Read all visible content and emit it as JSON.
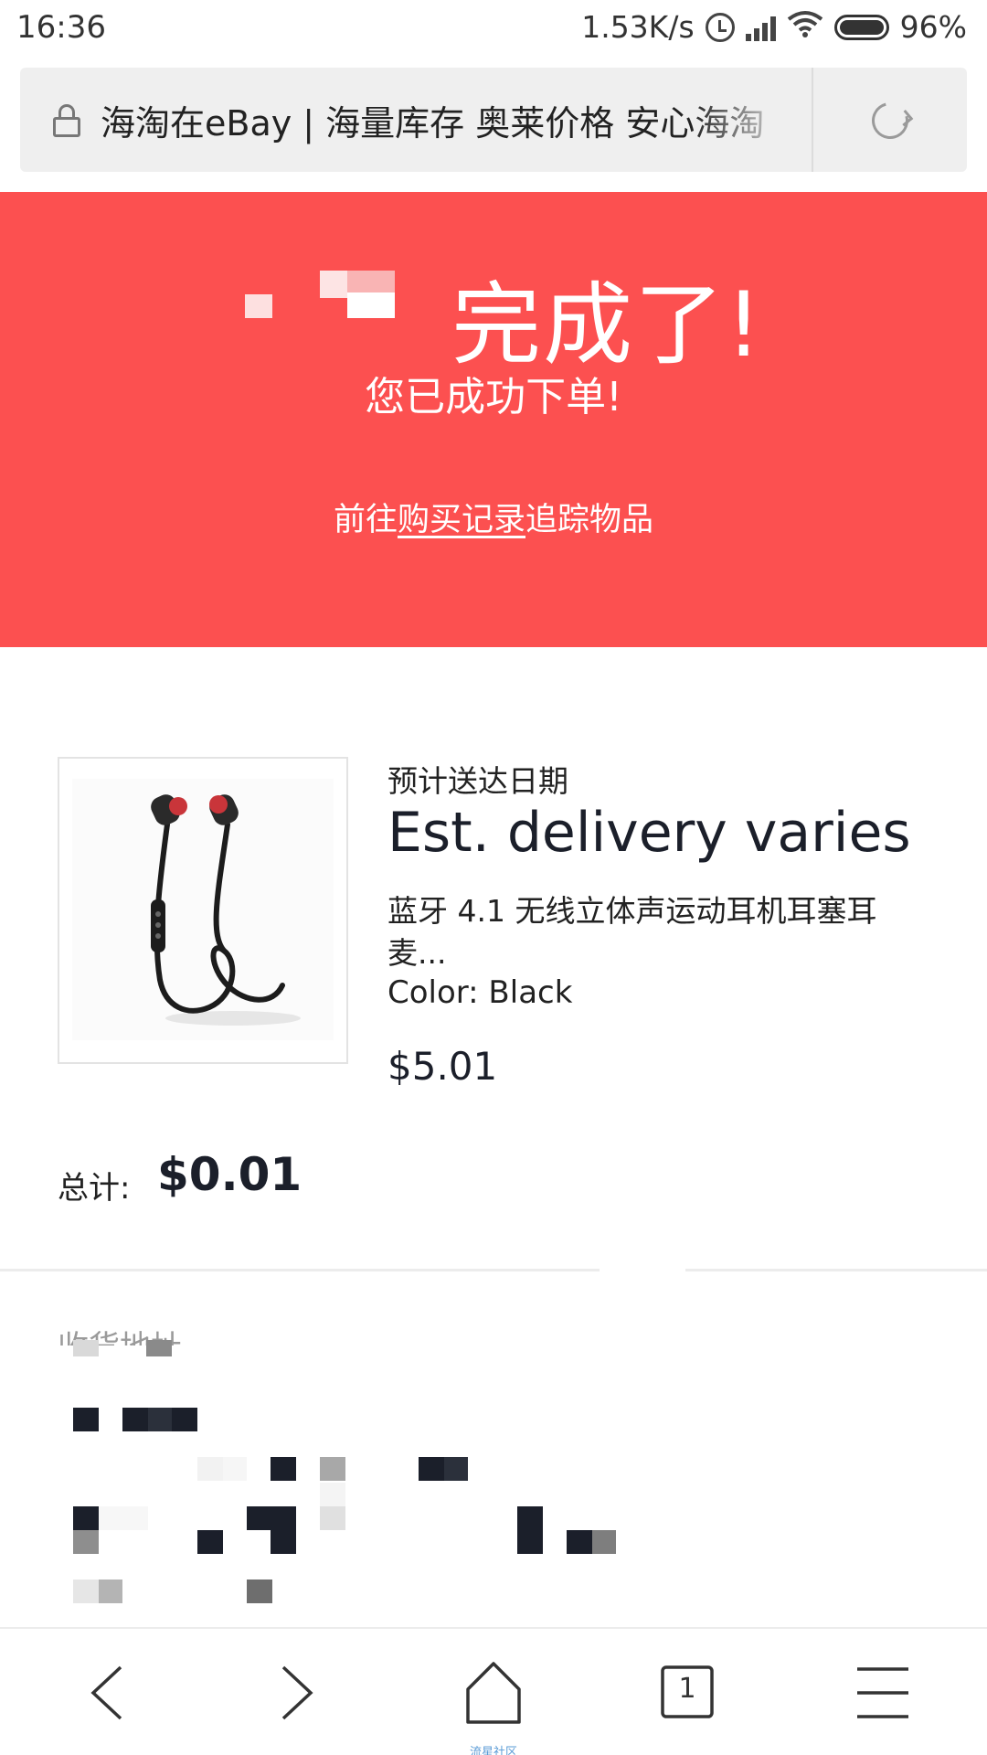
{
  "status_bar": {
    "time": "16:36",
    "network_speed": "1.53K/s",
    "battery": "96%",
    "icons": [
      "alarm-icon",
      "signal-icon",
      "wifi-icon",
      "battery-icon"
    ]
  },
  "url_bar": {
    "page_title": "海淘在eBay | 海量库存 奥莱价格 安心海淘",
    "icons": [
      "lock-icon",
      "reload-icon"
    ]
  },
  "hero": {
    "background": "#fc5050",
    "title": "完成了!",
    "subtitle": "您已成功下单!",
    "link_prefix": "前往",
    "link_text": "购买记录",
    "link_suffix": "追踪物品"
  },
  "item": {
    "delivery_label": "预计送达日期",
    "delivery_value": "Est. delivery varies",
    "title": "蓝牙 4.1 无线立体声运动耳机耳塞耳麦...",
    "variant": "Color: Black",
    "price": "$5.01",
    "image": "earphones-image"
  },
  "total": {
    "label": "总计:",
    "value": "$0.01"
  },
  "address": {
    "label": "收货地址"
  },
  "bottom_nav": {
    "tab_count": "1",
    "caption": "流星社区",
    "icons": [
      "back-icon",
      "forward-icon",
      "home-icon",
      "tabs-icon",
      "menu-icon"
    ]
  }
}
